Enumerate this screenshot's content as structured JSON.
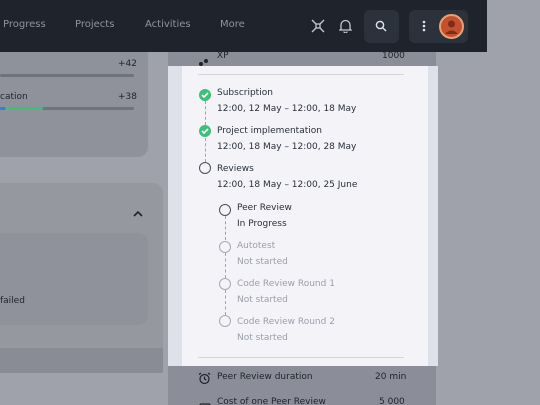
{
  "nav": {
    "items": [
      "Progress",
      "Projects",
      "Activities",
      "More"
    ]
  },
  "left_panel": {
    "row1_value": "+42",
    "row2_label": "cation",
    "row2_value": "+38",
    "fail_text": "failed"
  },
  "right_panel": {
    "xp_label": "XP",
    "xp_value": "1000",
    "peer_review_duration_label": "Peer Review duration",
    "peer_review_duration_value": "20 min",
    "cost_label": "Cost of one Peer Review",
    "cost_value": "5 000"
  },
  "timeline": {
    "steps": [
      {
        "title": "Subscription",
        "dates": "12:00, 12 May – 12:00, 18 May",
        "status": "done"
      },
      {
        "title": "Project implementation",
        "dates": "12:00, 18 May – 12:00, 28 May",
        "status": "done"
      },
      {
        "title": "Reviews",
        "dates": "12:00, 18 May – 12:00, 25 June",
        "status": "open"
      }
    ],
    "substeps": [
      {
        "title": "Peer Review",
        "status": "In Progress",
        "active": true
      },
      {
        "title": "Autotest",
        "status": "Not started",
        "active": false
      },
      {
        "title": "Code Review Round 1",
        "status": "Not started",
        "active": false
      },
      {
        "title": "Code Review Round 2",
        "status": "Not started",
        "active": false
      }
    ]
  },
  "colors": {
    "navbar": "#1e232c",
    "done": "#3cc07a",
    "progress_blue": "#3a7bd5",
    "progress_green": "#3cc07a"
  },
  "icons": {
    "network": "network-icon",
    "bell": "bell-icon",
    "search": "search-icon",
    "kebab": "kebab-menu-icon",
    "avatar": "avatar",
    "xp": "xp-icon",
    "alarm": "alarm-clock-icon",
    "cost": "wallet-icon",
    "chevron": "chevron-up-icon"
  }
}
